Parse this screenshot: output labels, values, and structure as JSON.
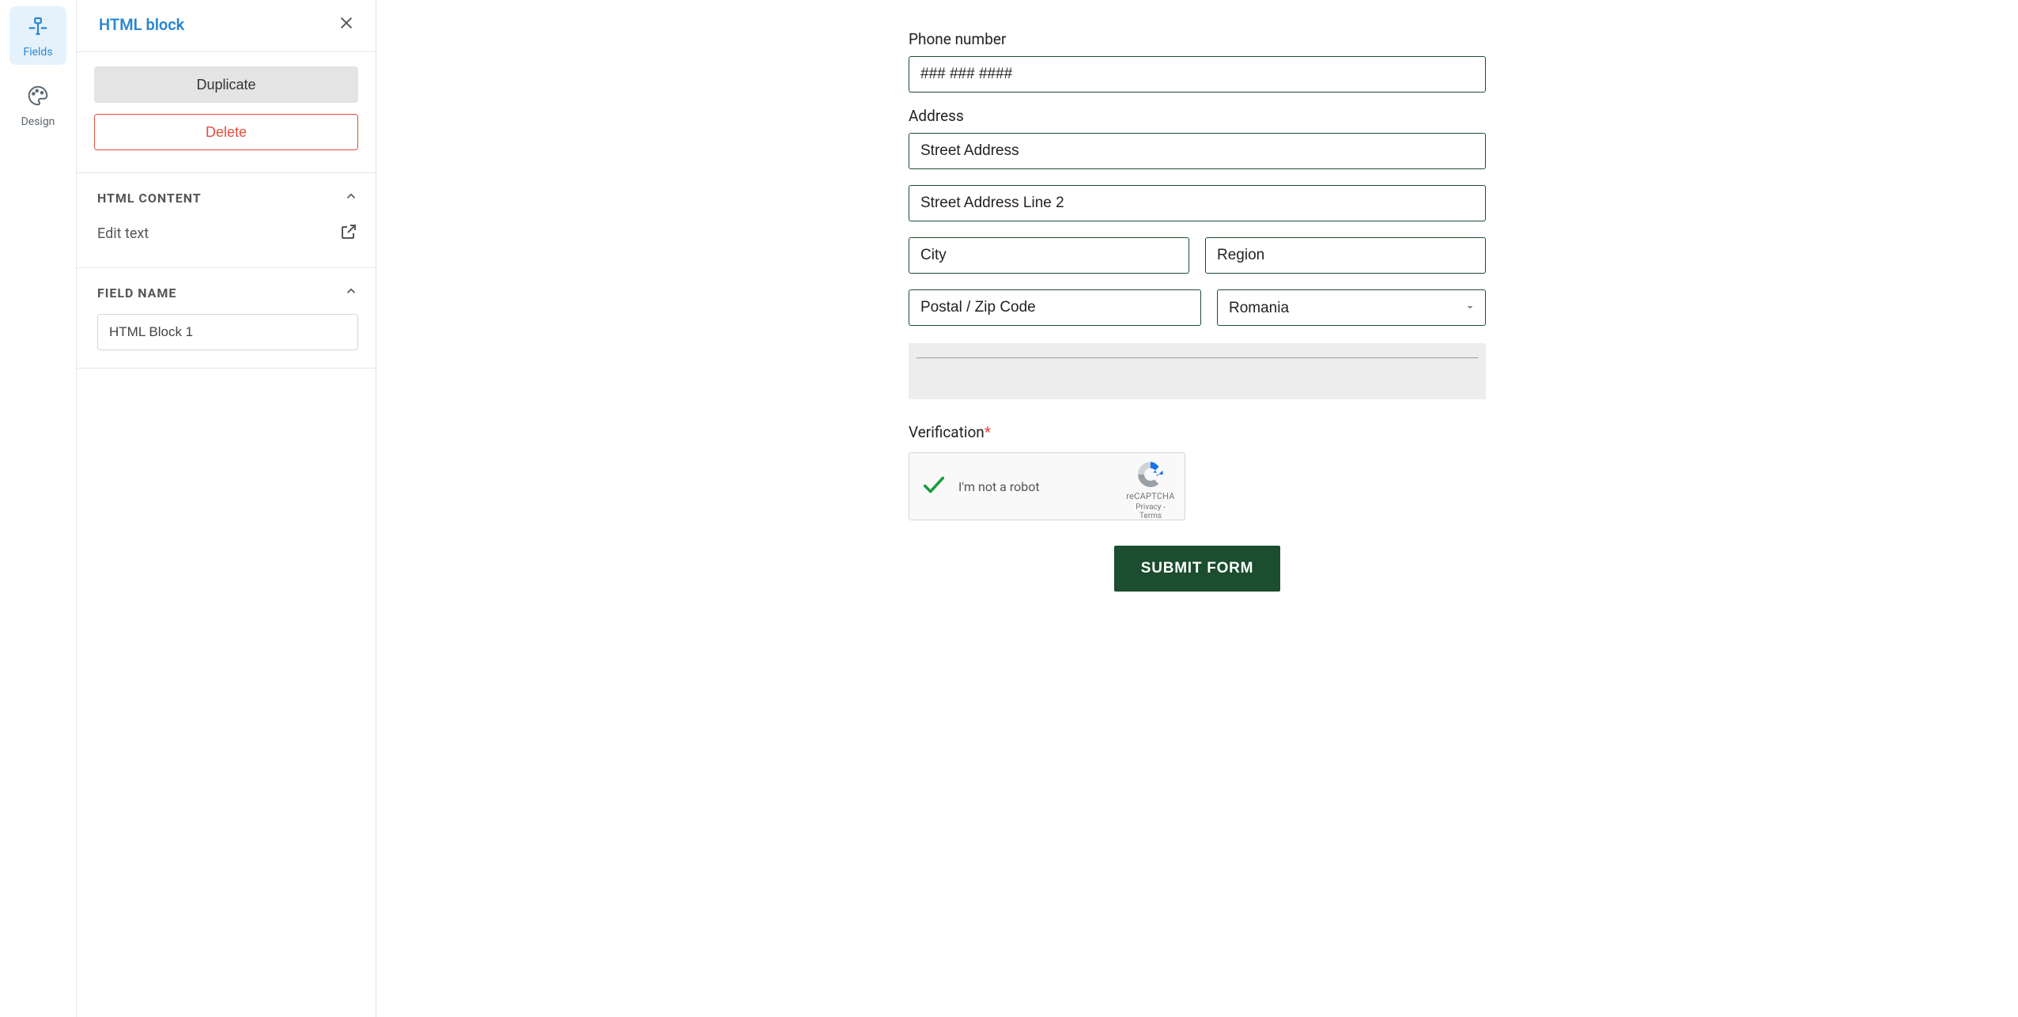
{
  "rail": {
    "fields_label": "Fields",
    "design_label": "Design"
  },
  "panel": {
    "title": "HTML block",
    "duplicate_label": "Duplicate",
    "delete_label": "Delete",
    "sections": {
      "html_content": {
        "title": "HTML CONTENT",
        "edit_text_label": "Edit text"
      },
      "field_name": {
        "title": "FIELD NAME",
        "value": "HTML Block 1"
      }
    }
  },
  "form": {
    "phone": {
      "label": "Phone number",
      "placeholder": "### ### ####"
    },
    "address": {
      "label": "Address",
      "street_placeholder": "Street Address",
      "street2_placeholder": "Street Address Line 2",
      "city_placeholder": "City",
      "region_placeholder": "Region",
      "postal_placeholder": "Postal / Zip Code",
      "country_value": "Romania"
    },
    "verification": {
      "label": "Verification",
      "robot_text": "I'm not a robot",
      "brand": "reCAPTCHA",
      "links": "Privacy - Terms"
    },
    "submit_label": "SUBMIT FORM"
  }
}
